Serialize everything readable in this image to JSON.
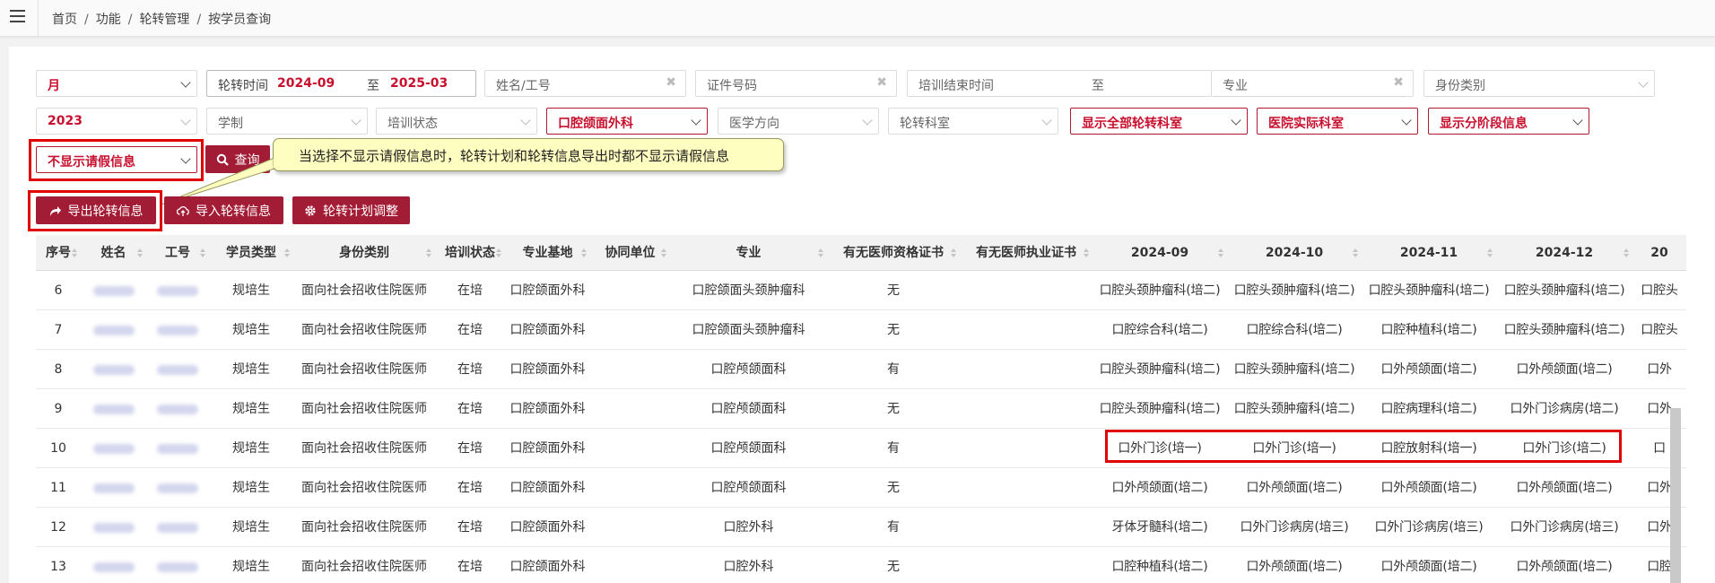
{
  "breadcrumb": [
    "首页",
    "功能",
    "轮转管理",
    "按学员查询"
  ],
  "filters": {
    "period": "月",
    "rotation_time_label": "轮转时间",
    "rotation_start": "2024-09",
    "to_label": "至",
    "rotation_end": "2025-03",
    "name_placeholder": "姓名/工号",
    "cert_placeholder": "证件号码",
    "end_time_label": "培训结束时间",
    "end_time_to": "至",
    "major_placeholder": "专业",
    "identity_placeholder": "身份类别",
    "year": "2023",
    "edu_placeholder": "学制",
    "status_placeholder": "培训状态",
    "major_base": "口腔颌面外科",
    "direction_placeholder": "医学方向",
    "dept_placeholder": "轮转科室",
    "show_all_depts": "显示全部轮转科室",
    "hospital_dept": "医院实际科室",
    "show_stages": "显示分阶段信息",
    "leave_info": "不显示请假信息",
    "query_button": "查询"
  },
  "tooltip": "当选择不显示请假信息时，轮转计划和轮转信息导出时都不显示请假信息",
  "actions": {
    "export": "导出轮转信息",
    "import": "导入轮转信息",
    "adjust": "轮转计划调整"
  },
  "icons": {
    "menu": "hamburger-icon",
    "search": "search-icon",
    "export": "share-arrow-icon",
    "import": "cloud-upload-icon",
    "adjust": "gear-icon"
  },
  "colors": {
    "accent": "#a31c35",
    "highlight": "#e00000",
    "tooltip_bg": "#fefec0"
  },
  "table": {
    "headers": [
      "序号",
      "姓名",
      "工号",
      "学员类型",
      "身份类别",
      "培训状态",
      "专业基地",
      "协同单位",
      "专业",
      "有无医师资格证书",
      "有无医师执业证书",
      "2024-09",
      "2024-10",
      "2024-11",
      "2024-12",
      "20"
    ],
    "rows": [
      [
        "6",
        "",
        "",
        "规培生",
        "面向社会招收住院医师",
        "在培",
        "口腔颌面外科",
        "",
        "口腔颌面头颈肿瘤科",
        "无",
        "",
        "口腔头颈肿瘤科(培二)",
        "口腔头颈肿瘤科(培二)",
        "口腔头颈肿瘤科(培二)",
        "口腔头颈肿瘤科(培二)",
        "口腔头"
      ],
      [
        "7",
        "",
        "",
        "规培生",
        "面向社会招收住院医师",
        "在培",
        "口腔颌面外科",
        "",
        "口腔颌面头颈肿瘤科",
        "无",
        "",
        "口腔综合科(培二)",
        "口腔综合科(培二)",
        "口腔种植科(培二)",
        "口腔头颈肿瘤科(培二)",
        "口腔头"
      ],
      [
        "8",
        "",
        "",
        "规培生",
        "面向社会招收住院医师",
        "在培",
        "口腔颌面外科",
        "",
        "口腔颅颌面科",
        "有",
        "",
        "口腔头颈肿瘤科(培二)",
        "口腔头颈肿瘤科(培二)",
        "口外颅颌面(培二)",
        "口外颅颌面(培二)",
        "口外"
      ],
      [
        "9",
        "",
        "",
        "规培生",
        "面向社会招收住院医师",
        "在培",
        "口腔颌面外科",
        "",
        "口腔颅颌面科",
        "无",
        "",
        "口腔头颈肿瘤科(培二)",
        "口腔头颈肿瘤科(培二)",
        "口腔病理科(培二)",
        "口外门诊病房(培二)",
        "口外"
      ],
      [
        "10",
        "",
        "",
        "规培生",
        "面向社会招收住院医师",
        "在培",
        "口腔颌面外科",
        "",
        "口腔颅颌面科",
        "有",
        "",
        "口外门诊(培一)",
        "口外门诊(培一)",
        "口腔放射科(培一)",
        "口外门诊(培二)",
        "口"
      ],
      [
        "11",
        "",
        "",
        "规培生",
        "面向社会招收住院医师",
        "在培",
        "口腔颌面外科",
        "",
        "口腔颅颌面科",
        "无",
        "",
        "口外颅颌面(培二)",
        "口外颅颌面(培二)",
        "口外颅颌面(培二)",
        "口外颅颌面(培二)",
        "口外"
      ],
      [
        "12",
        "",
        "",
        "规培生",
        "面向社会招收住院医师",
        "在培",
        "口腔颌面外科",
        "",
        "口腔外科",
        "有",
        "",
        "牙体牙髓科(培二)",
        "口外门诊病房(培三)",
        "口外门诊病房(培三)",
        "口外门诊病房(培三)",
        "口外"
      ],
      [
        "13",
        "",
        "",
        "规培生",
        "面向社会招收住院医师",
        "在培",
        "口腔颌面外科",
        "",
        "口腔外科",
        "无",
        "",
        "口腔种植科(培二)",
        "口外颅颌面(培二)",
        "口外颅颌面(培二)",
        "口外颅颌面(培二)",
        "口腔"
      ]
    ]
  }
}
